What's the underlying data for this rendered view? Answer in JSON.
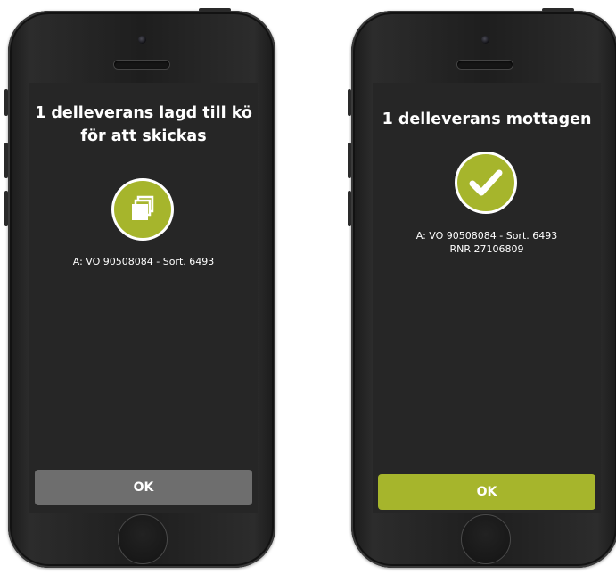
{
  "colors": {
    "accent": "#a6b52c",
    "screen_background": "#262626",
    "button_disabled": "#6e6e6e",
    "text": "#ffffff"
  },
  "screens": [
    {
      "title_line1": "1 delleverans lagd till kö",
      "title_line2": "för att skickas",
      "icon": "copy-icon",
      "info_line1": "A: VO 90508084 - Sort. 6493",
      "button_label": "OK"
    },
    {
      "title_line1": "1 delleverans mottagen",
      "icon": "checkmark-icon",
      "info_line1": "A: VO 90508084 - Sort. 6493",
      "info_line2": "RNR 27106809",
      "button_label": "OK"
    }
  ]
}
